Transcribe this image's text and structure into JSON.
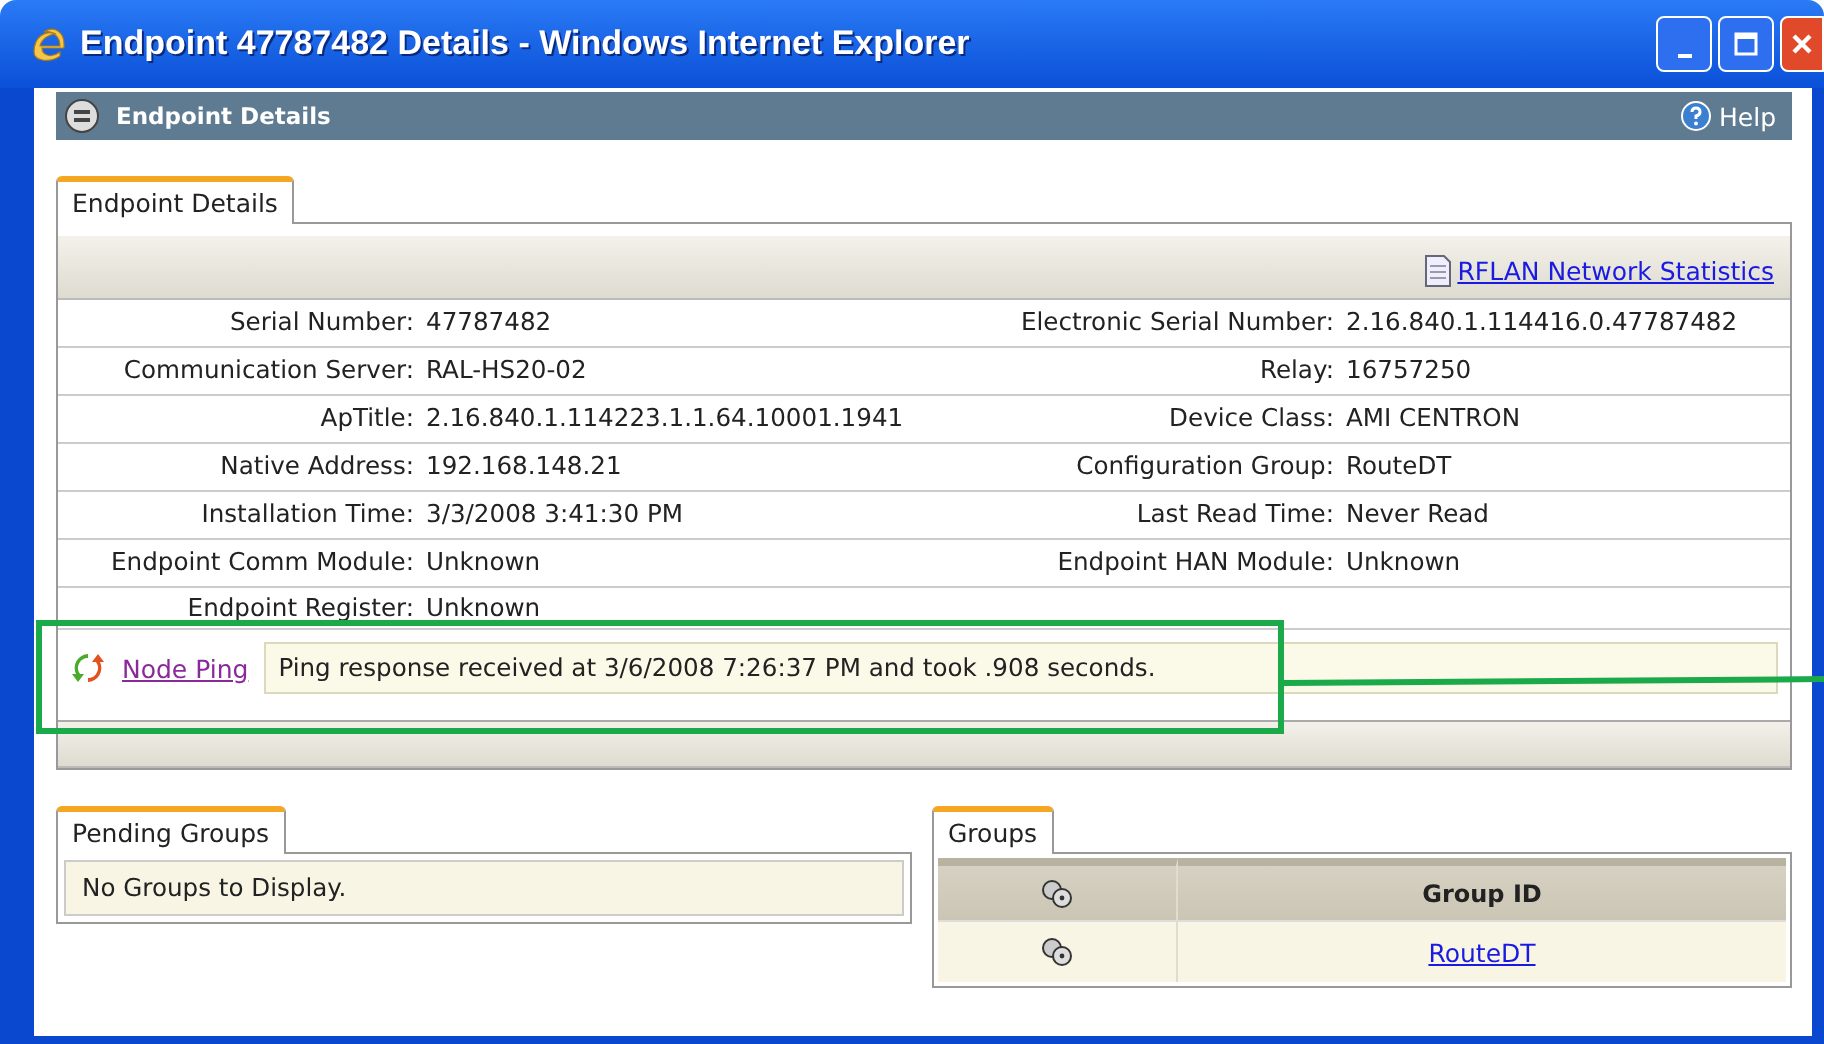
{
  "window": {
    "title": "Endpoint 47787482 Details - Windows Internet Explorer"
  },
  "header": {
    "title": "Endpoint Details",
    "help": "Help"
  },
  "tabs": [
    {
      "label": "Endpoint Details",
      "selected": true
    }
  ],
  "toolbar_link": "RFLAN Network Statistics",
  "rows": [
    {
      "left": {
        "label": "Serial Number:",
        "value": "47787482"
      },
      "right": {
        "label": "Electronic Serial Number:",
        "value": "2.16.840.1.114416.0.47787482"
      }
    },
    {
      "left": {
        "label": "Communication Server:",
        "value": "RAL-HS20-02"
      },
      "right": {
        "label": "Relay:",
        "value": "16757250"
      }
    },
    {
      "left": {
        "label": "ApTitle:",
        "value": "2.16.840.1.114223.1.1.64.10001.1941"
      },
      "right": {
        "label": "Device Class:",
        "value": "AMI CENTRON"
      }
    },
    {
      "left": {
        "label": "Native Address:",
        "value": "192.168.148.21"
      },
      "right": {
        "label": "Configuration Group:",
        "value": "RouteDT"
      }
    },
    {
      "left": {
        "label": "Installation Time:",
        "value": "3/3/2008 3:41:30 PM"
      },
      "right": {
        "label": "Last Read Time:",
        "value": "Never Read"
      }
    },
    {
      "left": {
        "label": "Endpoint Comm Module:",
        "value": "Unknown"
      },
      "right": {
        "label": "Endpoint HAN Module:",
        "value": "Unknown"
      }
    },
    {
      "left": {
        "label": "Endpoint Register:",
        "value": "Unknown"
      }
    }
  ],
  "ping": {
    "link": "Node Ping",
    "message": "Ping response received at 3/6/2008 7:26:37 PM and took .908 seconds."
  },
  "pending_groups": {
    "tabs": [
      {
        "label": "Pending Groups",
        "selected": true
      }
    ],
    "message": "No Groups to Display."
  },
  "groups": {
    "tabs": [
      {
        "label": "Groups",
        "selected": true
      }
    ],
    "columns": [
      "Group ID"
    ],
    "rows": [
      {
        "group_id": "RouteDT"
      }
    ]
  }
}
